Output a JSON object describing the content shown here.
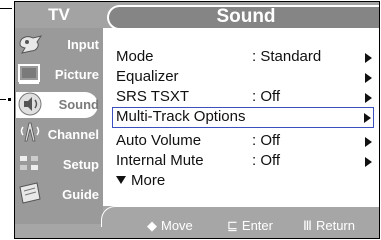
{
  "header": {
    "tv_label": "TV",
    "title": "Sound"
  },
  "sidebar": {
    "items": [
      {
        "label": "Input",
        "icon": "input-icon",
        "active": false
      },
      {
        "label": "Picture",
        "icon": "picture-icon",
        "active": false
      },
      {
        "label": "Sound",
        "icon": "sound-icon",
        "active": true
      },
      {
        "label": "Channel",
        "icon": "channel-icon",
        "active": false
      },
      {
        "label": "Setup",
        "icon": "setup-icon",
        "active": false
      },
      {
        "label": "Guide",
        "icon": "guide-icon",
        "active": false
      }
    ]
  },
  "menu": {
    "items": [
      {
        "label": "Mode",
        "value": ": Standard",
        "selected": false
      },
      {
        "label": "Equalizer",
        "value": "",
        "selected": false
      },
      {
        "label": "SRS TSXT",
        "value": ": Off",
        "selected": false
      },
      {
        "label": "Multi-Track Options",
        "value": "",
        "selected": true
      },
      {
        "label": "Auto Volume",
        "value": ": Off",
        "selected": false
      },
      {
        "label": "Internal Mute",
        "value": ": Off",
        "selected": false
      }
    ],
    "more_label": "More"
  },
  "footer": {
    "move": {
      "glyph": "◆",
      "label": "Move"
    },
    "enter": {
      "glyph": "⊑",
      "label": "Enter"
    },
    "return": {
      "glyph": "Ⅲ",
      "label": "Return"
    }
  },
  "colors": {
    "selection_border": "#3c4fbf",
    "panel_gray": "#9a9a9a",
    "title_gray": "#858585"
  }
}
